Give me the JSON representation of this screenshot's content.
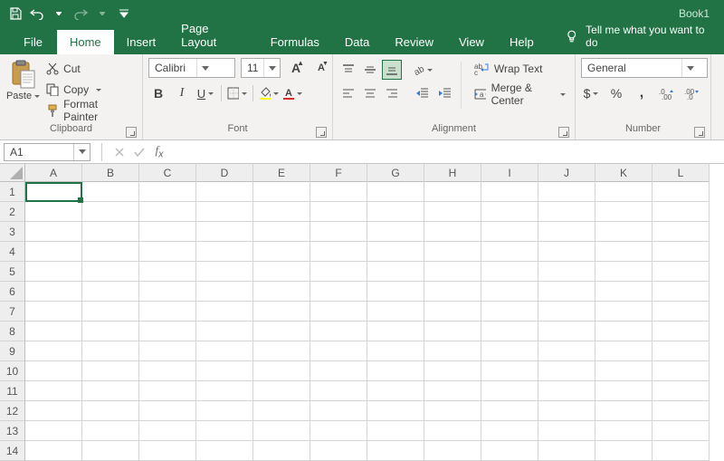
{
  "titlebar": {
    "doc_title": "Book1"
  },
  "tabs": {
    "file": "File",
    "home": "Home",
    "insert": "Insert",
    "page_layout": "Page Layout",
    "formulas": "Formulas",
    "data": "Data",
    "review": "Review",
    "view": "View",
    "help": "Help",
    "tellme": "Tell me what you want to do"
  },
  "clipboard": {
    "paste": "Paste",
    "cut": "Cut",
    "copy": "Copy",
    "format_painter": "Format Painter",
    "group_label": "Clipboard"
  },
  "font": {
    "name": "Calibri",
    "size": "11",
    "group_label": "Font",
    "bold": "B",
    "italic": "I",
    "underline": "U"
  },
  "alignment": {
    "wrap": "Wrap Text",
    "merge": "Merge & Center",
    "group_label": "Alignment"
  },
  "number": {
    "format": "General",
    "group_label": "Number"
  },
  "formula_bar": {
    "name_box": "A1",
    "formula": ""
  },
  "grid": {
    "columns": [
      "A",
      "B",
      "C",
      "D",
      "E",
      "F",
      "G",
      "H",
      "I",
      "J",
      "K",
      "L"
    ],
    "rows": [
      "1",
      "2",
      "3",
      "4",
      "5",
      "6",
      "7",
      "8",
      "9",
      "10",
      "11",
      "12",
      "13",
      "14"
    ]
  }
}
